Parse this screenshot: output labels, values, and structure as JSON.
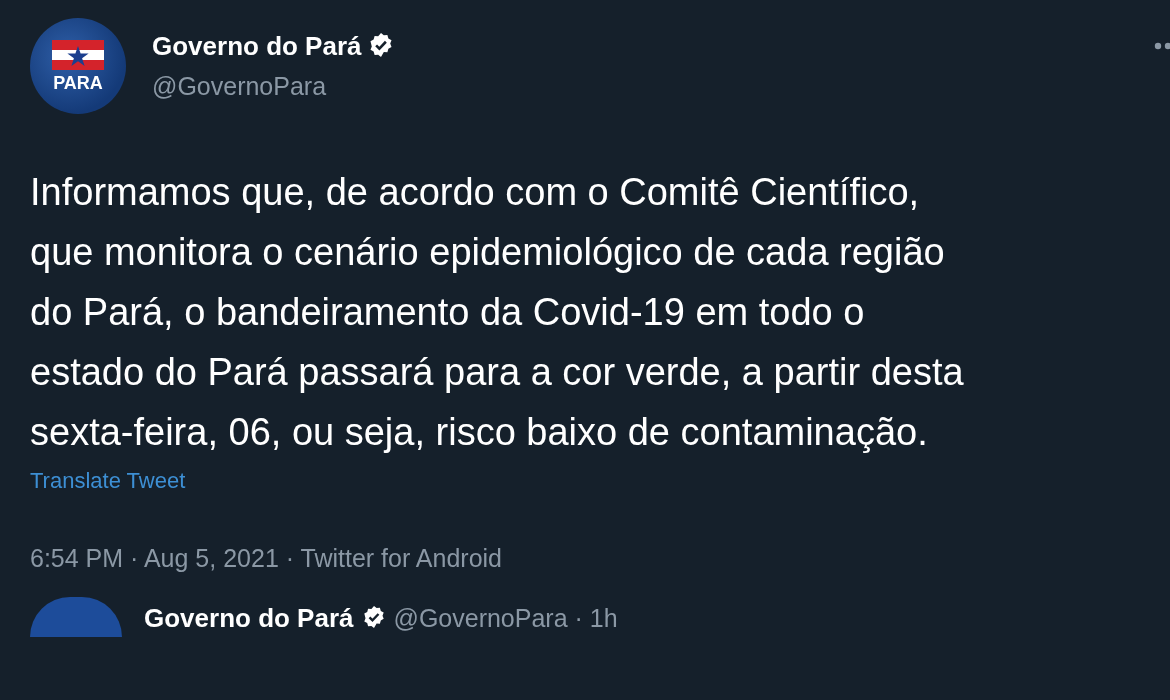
{
  "tweet": {
    "author": {
      "name": "Governo do Pará",
      "handle": "@GovernoPara",
      "verified": true,
      "logo_text": "PARA"
    },
    "text": "Informamos que, de acordo com o Comitê Científico,\nque monitora o cenário epidemiológico de cada região\ndo Pará, o bandeiramento da Covid-19 em todo o\nestado do Pará passará para a cor verde, a partir desta\nsexta-feira, 06, ou seja, risco baixo de contaminação.",
    "translate_link": "Translate Tweet",
    "timestamp": "6:54 PM · Aug 5, 2021 · Twitter for Android"
  },
  "next_tweet": {
    "author": {
      "name": "Governo do Pará",
      "verified": true,
      "meta": "@GovernoPara · 1h"
    }
  }
}
